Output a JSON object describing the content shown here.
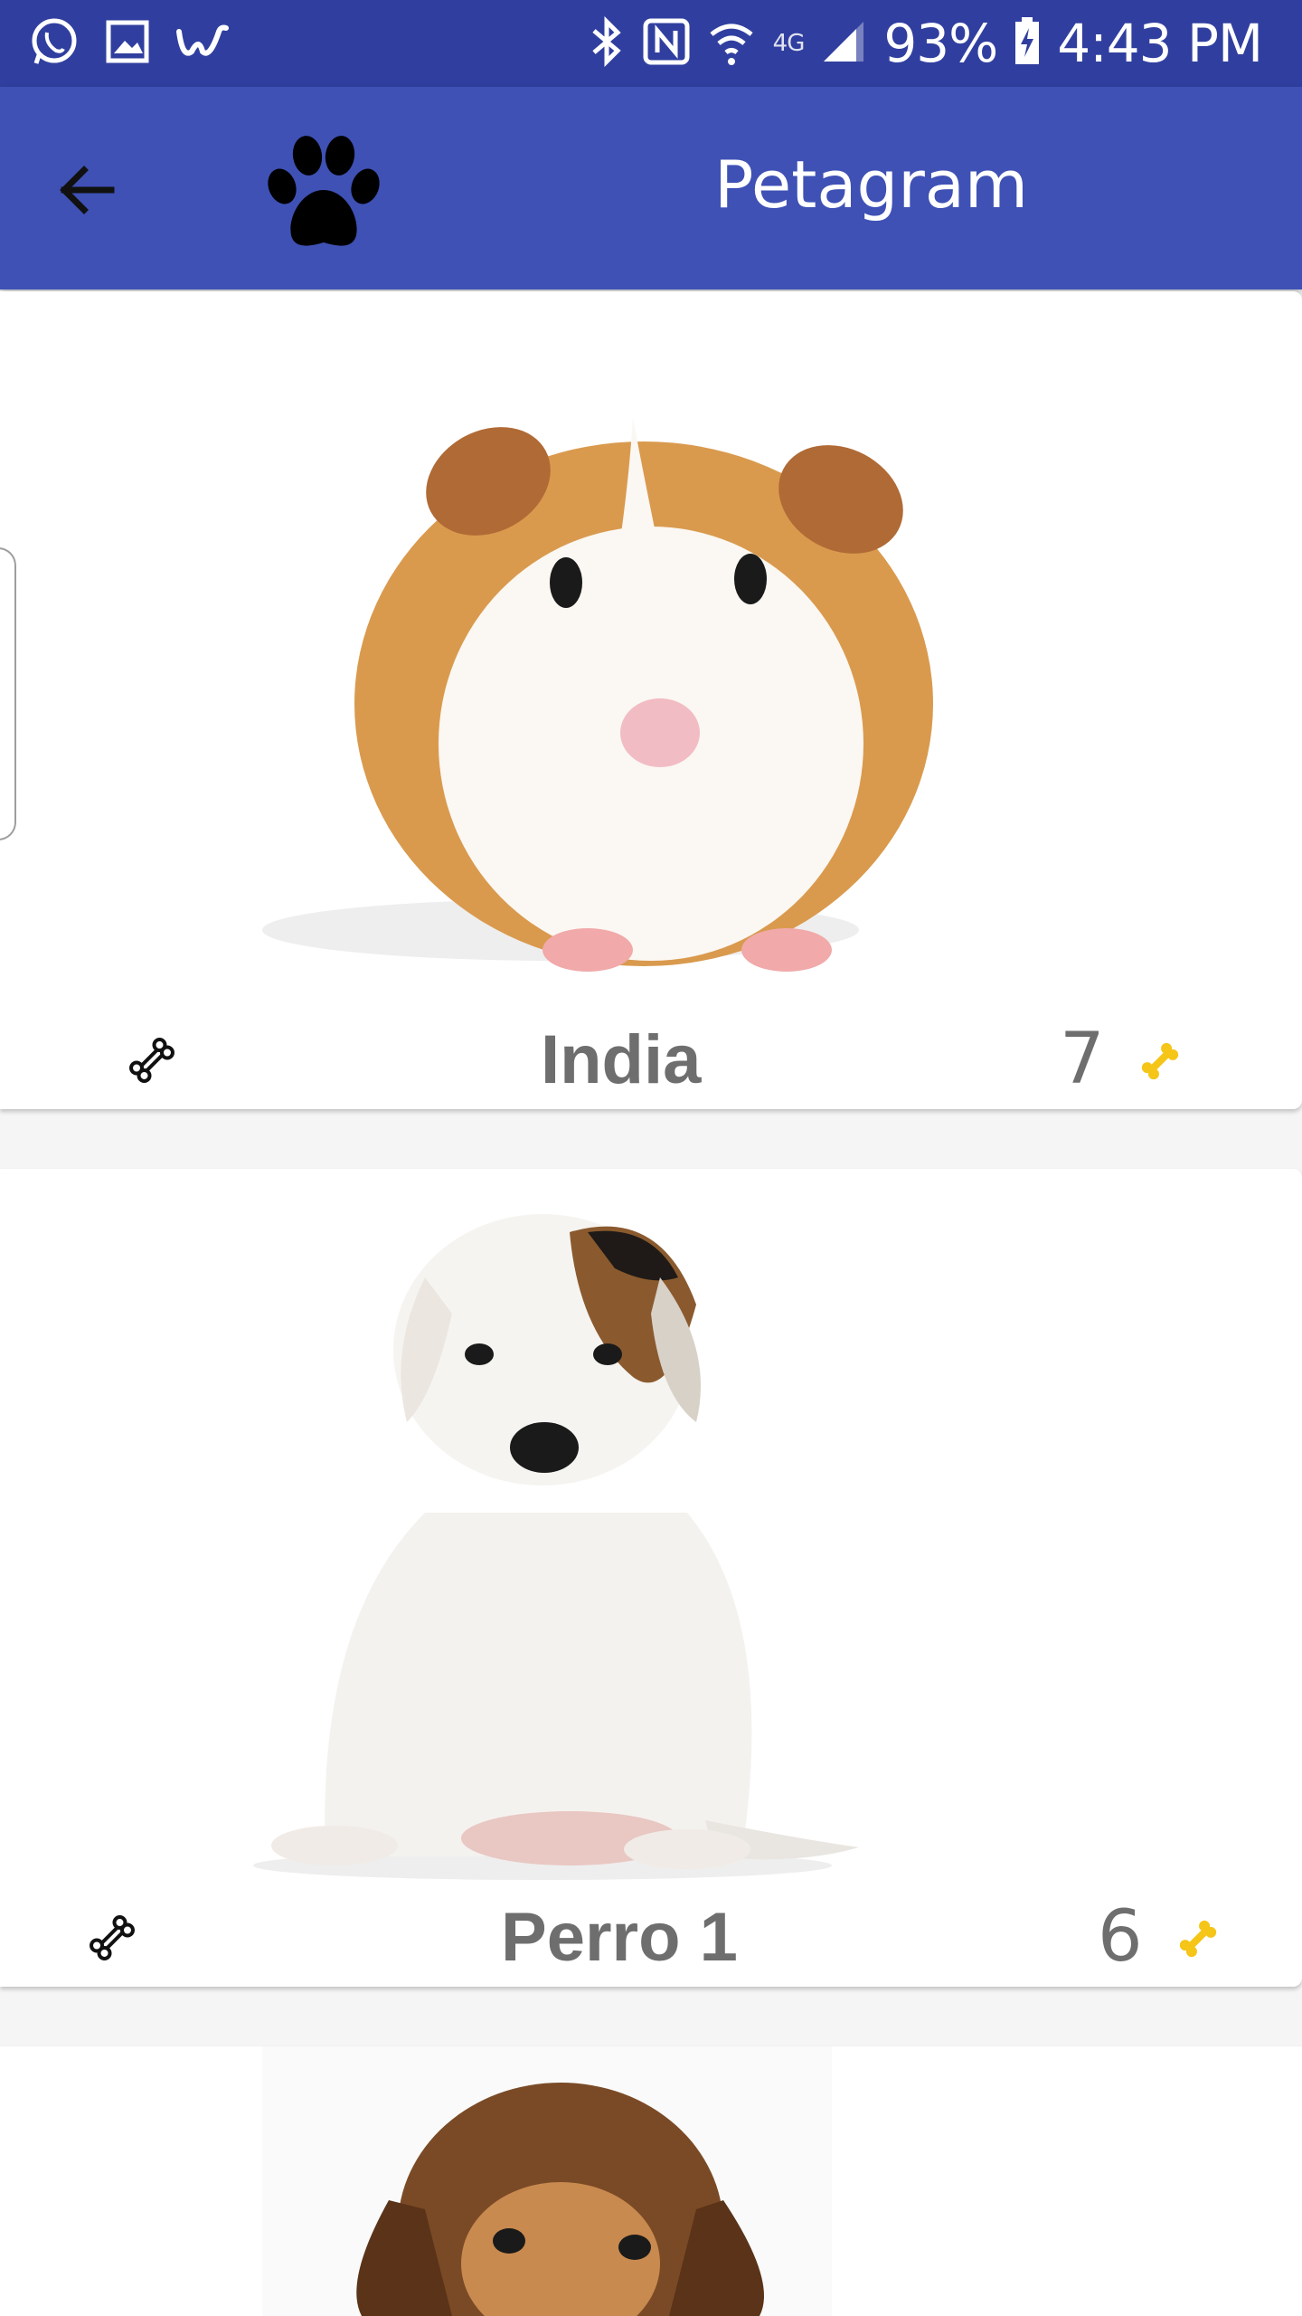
{
  "status_bar": {
    "battery": "93%",
    "time": "4:43 PM",
    "network": "4G",
    "icons": [
      "whatsapp-icon",
      "gallery-icon",
      "wish-icon",
      "bluetooth-icon",
      "nfc-icon",
      "wifi-icon",
      "signal-icon",
      "battery-icon"
    ]
  },
  "app_bar": {
    "title": "Petagram",
    "back_icon": "arrow-back-icon",
    "logo_icon": "paw-icon"
  },
  "pets": [
    {
      "name": "India",
      "likes": "7",
      "photo": "guinea-pig-photo"
    },
    {
      "name": "Perro 1",
      "likes": "6",
      "photo": "white-puppy-photo"
    },
    {
      "name": "",
      "likes": "",
      "photo": "brown-puppy-photo"
    }
  ],
  "colors": {
    "status_bar": "#303f9f",
    "app_bar": "#3f51b5",
    "name_text": "#6e6e6e",
    "bone_gold": "#f5c518"
  }
}
